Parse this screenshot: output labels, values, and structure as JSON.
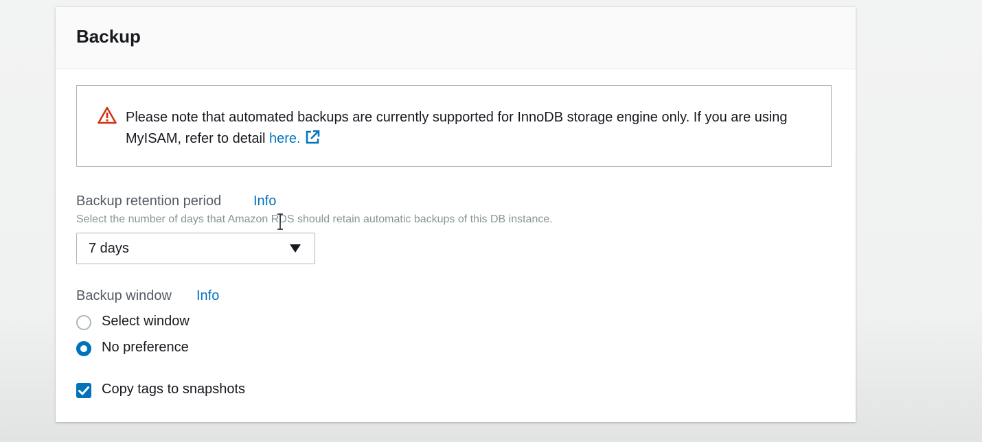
{
  "section": {
    "title": "Backup"
  },
  "alert": {
    "icon": "warning-triangle-icon",
    "text_before_link": "Please note that automated backups are currently supported for InnoDB storage engine only. If you are using MyISAM, refer to detail ",
    "link_text": "here.",
    "link_icon": "external-link-icon"
  },
  "retention": {
    "label": "Backup retention period",
    "info": "Info",
    "description": "Select the number of days that Amazon RDS should retain automatic backups of this DB instance.",
    "selected": "7 days"
  },
  "window": {
    "label": "Backup window",
    "info": "Info",
    "options": [
      {
        "label": "Select window",
        "selected": false
      },
      {
        "label": "No preference",
        "selected": true
      }
    ]
  },
  "copy_tags": {
    "label": "Copy tags to snapshots",
    "checked": true
  },
  "colors": {
    "accent": "#0073bb",
    "warning": "#d13212",
    "text": "#16191f",
    "secondary_text": "#545b64",
    "border": "#aab7b8"
  }
}
